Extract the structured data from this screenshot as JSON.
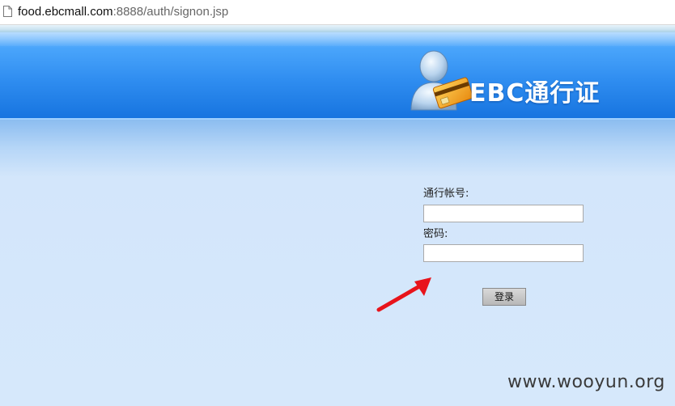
{
  "addressbar": {
    "url_domain": "food.ebcmall.com",
    "url_rest": ":8888/auth/signon.jsp"
  },
  "header": {
    "logo_text": "EBC通行证",
    "logo_icon": "user-card-icon"
  },
  "login_form": {
    "account_label": "通行帐号:",
    "account_value": "",
    "password_label": "密码:",
    "password_value": "",
    "submit_label": "登录"
  },
  "annotation": {
    "arrow_icon": "red-arrow-icon",
    "arrow_color": "#e8141b"
  },
  "watermark": "www.wooyun.org",
  "colors": {
    "banner": "#2f8df0",
    "page_background": "#d6e8fb"
  }
}
